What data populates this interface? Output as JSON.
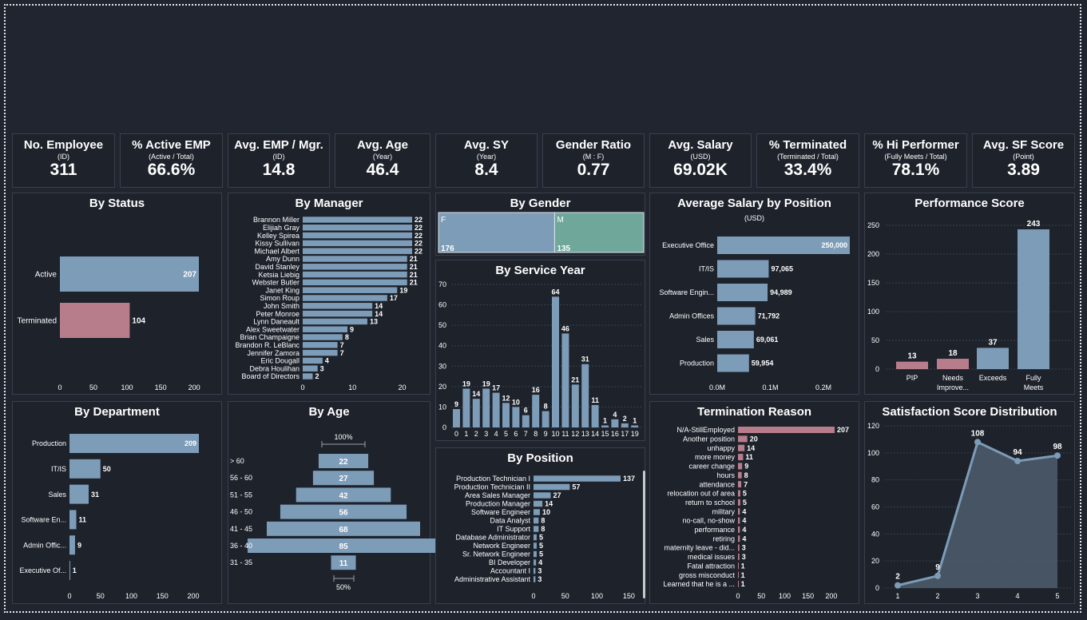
{
  "colors": {
    "bar_blue": "#7d9cb8",
    "bar_pink": "#b87d8b",
    "bar_teal": "#6fa89b",
    "background": "#202530",
    "panel": "#1d222b"
  },
  "kpis": [
    {
      "title": "No. Employee",
      "sub": "(ID)",
      "value": "311"
    },
    {
      "title": "% Active EMP",
      "sub": "(Active / Total)",
      "value": "66.6%"
    },
    {
      "title": "Avg. EMP / Mgr.",
      "sub": "(ID)",
      "value": "14.8"
    },
    {
      "title": "Avg. Age",
      "sub": "(Year)",
      "value": "46.4"
    },
    {
      "title": "Avg. SY",
      "sub": "(Year)",
      "value": "8.4"
    },
    {
      "title": "Gender Ratio",
      "sub": "(M : F)",
      "value": "0.77"
    },
    {
      "title": "Avg. Salary",
      "sub": "(USD)",
      "value": "69.02K"
    },
    {
      "title": "% Terminated",
      "sub": "(Terminated / Total)",
      "value": "33.4%"
    },
    {
      "title": "% Hi Performer",
      "sub": "(Fully Meets / Total)",
      "value": "78.1%"
    },
    {
      "title": "Avg. SF Score",
      "sub": "(Point)",
      "value": "3.89"
    }
  ],
  "panels": {
    "status": {
      "title": "By Status"
    },
    "manager": {
      "title": "By Manager"
    },
    "gender": {
      "title": "By Gender"
    },
    "service": {
      "title": "By Service Year"
    },
    "salary": {
      "title": "Average Salary by Position",
      "subtitle": "(USD)"
    },
    "performance": {
      "title": "Performance Score"
    },
    "department": {
      "title": "By Department"
    },
    "age": {
      "title": "By Age"
    },
    "position": {
      "title": "By Position"
    },
    "termination": {
      "title": "Termination Reason"
    },
    "satisfaction": {
      "title": "Satisfaction Score Distribution"
    }
  },
  "chart_data": [
    {
      "id": "status",
      "type": "bar",
      "orientation": "horizontal",
      "categories": [
        "Active",
        "Terminated"
      ],
      "values": [
        207,
        104
      ],
      "xticks": [
        0,
        50,
        100,
        150,
        200
      ]
    },
    {
      "id": "manager",
      "type": "bar",
      "orientation": "horizontal",
      "categories": [
        "Brannon Miller",
        "Elijiah Gray",
        "Kelley Spirea",
        "Kissy Sullivan",
        "Michael Albert",
        "Amy Dunn",
        "David Stanley",
        "Ketsia Liebig",
        "Webster Butler",
        "Janet King",
        "Simon Roup",
        "John Smith",
        "Peter Monroe",
        "Lynn Daneault",
        "Alex Sweetwater",
        "Brian Champaigne",
        "Brandon R. LeBlanc",
        "Jennifer Zamora",
        "Eric Dougall",
        "Debra Houlihan",
        "Board of Directors"
      ],
      "values": [
        22,
        22,
        22,
        22,
        22,
        21,
        21,
        21,
        21,
        19,
        17,
        14,
        14,
        13,
        9,
        8,
        7,
        7,
        4,
        3,
        2
      ],
      "xticks": [
        0,
        10,
        20
      ]
    },
    {
      "id": "gender",
      "type": "bar",
      "orientation": "stacked-horizontal",
      "categories": [
        "F",
        "M"
      ],
      "values": [
        176,
        135
      ]
    },
    {
      "id": "service",
      "type": "bar",
      "categories": [
        "0",
        "1",
        "2",
        "3",
        "4",
        "5",
        "6",
        "7",
        "8",
        "9",
        "10",
        "11",
        "12",
        "13",
        "14",
        "15",
        "16",
        "17",
        "19"
      ],
      "values": [
        9,
        19,
        14,
        19,
        17,
        12,
        10,
        6,
        16,
        8,
        64,
        46,
        21,
        31,
        11,
        1,
        4,
        2,
        1
      ],
      "yticks": [
        0,
        10,
        20,
        30,
        40,
        50,
        60,
        70
      ]
    },
    {
      "id": "salary",
      "type": "bar",
      "orientation": "horizontal",
      "categories": [
        "Executive Office",
        "IT/IS",
        "Software Engin...",
        "Admin Offices",
        "Sales",
        "Production"
      ],
      "values": [
        250000,
        97065,
        94989,
        71792,
        69061,
        59954
      ],
      "labels": [
        "250,000",
        "97,065",
        "94,989",
        "71,792",
        "69,061",
        "59,954"
      ],
      "xticks": [
        "0.0M",
        "0.1M",
        "0.2M"
      ]
    },
    {
      "id": "performance",
      "type": "bar",
      "categories": [
        "PIP",
        "Needs Improve...",
        "Exceeds",
        "Fully Meets"
      ],
      "values": [
        13,
        18,
        37,
        243
      ],
      "yticks": [
        0,
        50,
        100,
        150,
        200,
        250
      ]
    },
    {
      "id": "department",
      "type": "bar",
      "orientation": "horizontal",
      "categories": [
        "Production",
        "IT/IS",
        "Sales",
        "Software En...",
        "Admin Offic...",
        "Executive Of..."
      ],
      "values": [
        209,
        50,
        31,
        11,
        9,
        1
      ],
      "xticks": [
        0,
        50,
        100,
        150,
        200
      ]
    },
    {
      "id": "age",
      "type": "bar",
      "orientation": "funnel",
      "categories": [
        "> 60",
        "56 - 60",
        "51 - 55",
        "46 - 50",
        "41 - 45",
        "36 - 40",
        "31 - 35"
      ],
      "values": [
        22,
        27,
        42,
        56,
        68,
        85,
        11
      ],
      "top_label": "100%",
      "bottom_label": "50%"
    },
    {
      "id": "position",
      "type": "bar",
      "orientation": "horizontal",
      "categories": [
        "Production Technician I",
        "Production Technician II",
        "Area Sales Manager",
        "Production Manager",
        "Software Engineer",
        "Data Analyst",
        "IT Support",
        "Database Administrator",
        "Network Engineer",
        "Sr. Network Engineer",
        "BI Developer",
        "Accountant I",
        "Administrative Assistant"
      ],
      "values": [
        137,
        57,
        27,
        14,
        10,
        8,
        8,
        5,
        5,
        5,
        4,
        3,
        3
      ],
      "xticks": [
        0,
        50,
        100,
        150
      ]
    },
    {
      "id": "termination",
      "type": "bar",
      "orientation": "horizontal",
      "categories": [
        "N/A-StillEmployed",
        "Another position",
        "unhappy",
        "more money",
        "career change",
        "hours",
        "attendance",
        "relocation out of area",
        "return to school",
        "military",
        "no-call, no-show",
        "performance",
        "retiring",
        "maternity leave - did...",
        "medical issues",
        "Fatal attraction",
        "gross misconduct",
        "Learned that he is a ..."
      ],
      "values": [
        207,
        20,
        14,
        11,
        9,
        8,
        7,
        5,
        5,
        4,
        4,
        4,
        4,
        3,
        3,
        1,
        1,
        1
      ],
      "xticks": [
        0,
        50,
        100,
        150,
        200
      ]
    },
    {
      "id": "satisfaction",
      "type": "area",
      "x": [
        1,
        2,
        3,
        4,
        5
      ],
      "values": [
        2,
        9,
        108,
        94,
        98
      ],
      "yticks": [
        0,
        20,
        40,
        60,
        80,
        100,
        120
      ]
    }
  ]
}
